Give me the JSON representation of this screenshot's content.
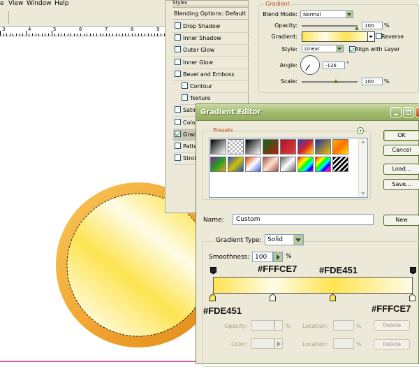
{
  "menu": {
    "items": [
      "e",
      "View",
      "Window",
      "Help"
    ]
  },
  "ruler": {
    "numbers": [
      "3",
      "4",
      "5",
      "6",
      "7",
      "8",
      "9"
    ]
  },
  "layer_style": {
    "header": "Styles",
    "blending_options": "Blending Options: Default",
    "items": [
      {
        "label": "Drop Shadow",
        "checked": false
      },
      {
        "label": "Inner Shadow",
        "checked": false
      },
      {
        "label": "Outer Glow",
        "checked": false
      },
      {
        "label": "Inner Glow",
        "checked": false
      },
      {
        "label": "Bevel and Emboss",
        "checked": false
      },
      {
        "label": "Contour",
        "checked": false
      },
      {
        "label": "Texture",
        "checked": false
      },
      {
        "label": "Satin",
        "checked": false
      },
      {
        "label": "Color",
        "checked": false
      },
      {
        "label": "Grad",
        "checked": true
      },
      {
        "label": "Patte",
        "checked": false
      },
      {
        "label": "Strok",
        "checked": false
      }
    ],
    "gradient_group_title": "Gradient",
    "blend_mode_label": "Blend Mode:",
    "blend_mode_value": "Normal",
    "opacity_label": "Opacity:",
    "opacity_value": "100",
    "percent": "%",
    "gradient_label": "Gradient:",
    "reverse_label": "Reverse",
    "style_label": "Style:",
    "style_value": "Linear",
    "align_label": "Align with Layer",
    "angle_label": "Angle:",
    "angle_value": "-126",
    "degree": "°",
    "scale_label": "Scale:",
    "scale_value": "100"
  },
  "gradient_editor": {
    "title": "Gradient Editor",
    "presets_label": "Presets",
    "buttons": {
      "ok": "OK",
      "cancel": "Cancel",
      "load": "Load...",
      "save": "Save...",
      "new": "New"
    },
    "name_label": "Name:",
    "name_value": "Custom",
    "gradient_type_label": "Gradient Type:",
    "gradient_type_value": "Solid",
    "smoothness_label": "Smoothness:",
    "smoothness_value": "100",
    "percent": "%",
    "color_stops": [
      {
        "location": 0,
        "color": "#FDE451"
      },
      {
        "location": 0.3,
        "color": "#FFFCE7"
      },
      {
        "location": 0.6,
        "color": "#FDE451"
      },
      {
        "location": 1,
        "color": "#FFFCE7"
      }
    ],
    "annotations": {
      "stop2": "#FFFCE7",
      "stop3": "#FDE451",
      "stop1": "#FDE451",
      "stop4": "#FFFCE7"
    },
    "stops_group": {
      "opacity_label": "Opacity:",
      "color_label": "Color:",
      "location_label": "Location:",
      "location_label2": "Location:",
      "percent": "%",
      "delete_label": "Delete",
      "delete_label2": "Delete"
    }
  },
  "colors": {
    "gold_dark": "#e69a1f",
    "gold_light": "#fde451",
    "cream": "#fffce7",
    "titlebar": "#a6bd73"
  }
}
